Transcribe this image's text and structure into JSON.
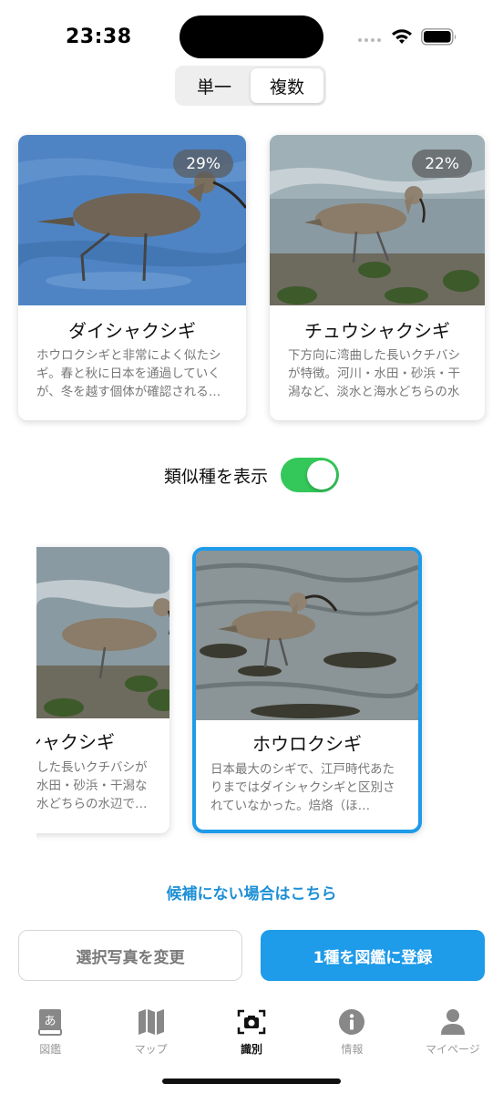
{
  "status_bar": {
    "time": "23:38"
  },
  "mode_toggle": {
    "options": [
      "単一",
      "複数"
    ],
    "selected": "複数"
  },
  "candidates": [
    {
      "name": "ダイシャクシギ",
      "confidence": "29%",
      "description": "ホウロクシギと非常によく似たシギ。春と秋に日本を通過していくが、冬を越す個体が確認される…"
    },
    {
      "name": "チュウシャクシギ",
      "confidence": "22%",
      "description": "下方向に湾曲した長いクチバシが特徴。河川・水田・砂浜・干潟など、淡水と海水どちらの水辺で…"
    }
  ],
  "similar_toggle": {
    "label": "類似種を表示",
    "on": true
  },
  "similar_species": [
    {
      "name": "シャクシギ",
      "description": "した長いクチバシが水田・砂浜・干潟な水どちらの水辺で…"
    },
    {
      "name": "ホウロクシギ",
      "description": "日本最大のシギで、江戸時代あたりまではダイシャクシギと区別されていなかった。焙烙（ほ…",
      "selected": true
    }
  ],
  "not_found_link": "候補にない場合はこちら",
  "actions": {
    "change_photo": "選択写真を変更",
    "register": "1種を図鑑に登録"
  },
  "tabs": [
    {
      "label": "図鑑",
      "icon": "book-icon"
    },
    {
      "label": "マップ",
      "icon": "map-icon"
    },
    {
      "label": "識別",
      "icon": "camera-scan-icon",
      "active": true
    },
    {
      "label": "情報",
      "icon": "info-icon"
    },
    {
      "label": "マイページ",
      "icon": "person-icon"
    }
  ],
  "colors": {
    "accent": "#1e9be9",
    "toggle_on": "#34c759",
    "muted_text": "#777777"
  }
}
